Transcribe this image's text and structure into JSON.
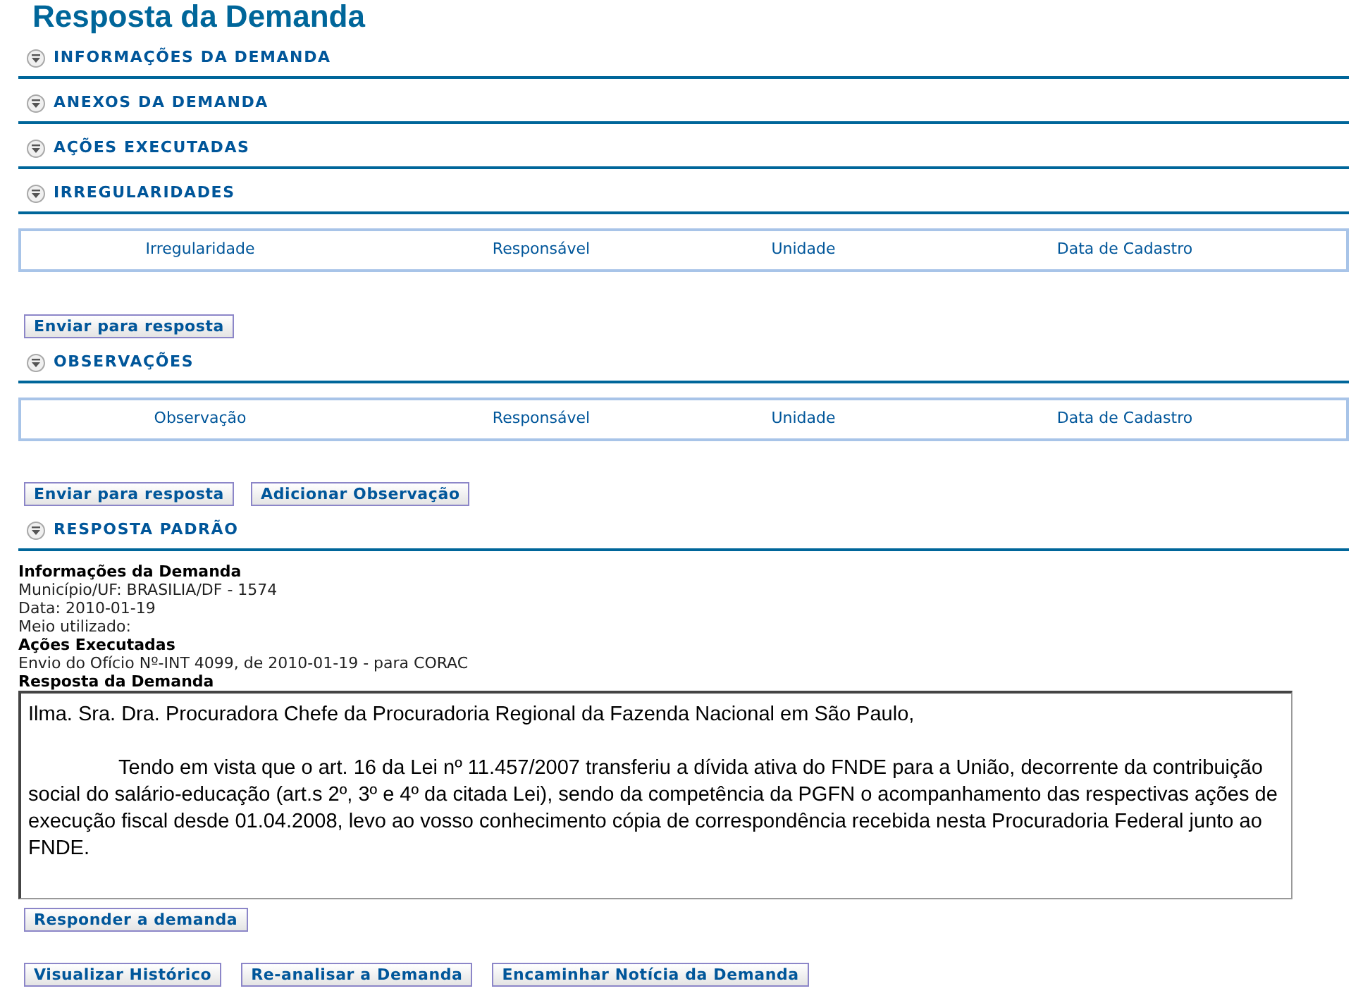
{
  "title": "Resposta da Demanda",
  "sections": [
    {
      "title": "INFORMAÇÕES DA DEMANDA",
      "expanded": true
    },
    {
      "title": "ANEXOS DA DEMANDA",
      "expanded": true
    },
    {
      "title": "AÇÕES EXECUTADAS",
      "expanded": true
    },
    {
      "title": "IRREGULARIDADES",
      "expanded": true,
      "table": {
        "columns": [
          "Irregularidade",
          "Responsável",
          "Unidade",
          "Data de Cadastro"
        ]
      },
      "buttons": [
        "Enviar para resposta"
      ]
    },
    {
      "title": "OBSERVAÇÕES",
      "expanded": true,
      "table": {
        "columns": [
          "Observação",
          "Responsável",
          "Unidade",
          "Data de Cadastro"
        ]
      },
      "buttons": [
        "Enviar para resposta",
        "Adicionar Observação"
      ]
    },
    {
      "title": "RESPOSTA PADRÃO",
      "expanded": true
    }
  ],
  "summary": [
    {
      "kind": "heading",
      "text": "Informações da Demanda"
    },
    {
      "kind": "text",
      "text": "Município/UF: BRASILIA/DF - 1574"
    },
    {
      "kind": "text",
      "text": "Data: 2010-01-19"
    },
    {
      "kind": "text",
      "text": "Meio utilizado:"
    },
    {
      "kind": "heading",
      "text": "Ações Executadas"
    },
    {
      "kind": "text",
      "text": "Envio do Ofício Nº-INT 4099, de 2010-01-19 - para CORAC"
    },
    {
      "kind": "heading",
      "text": "Resposta da Demanda"
    }
  ],
  "response": {
    "paragraphs": [
      {
        "indented": false,
        "text": "Ilma. Sra. Dra. Procuradora Chefe da Procuradoria Regional da Fazenda Nacional em São Paulo,"
      },
      {
        "indented": true,
        "text": "Tendo em vista que o art. 16 da Lei nº 11.457/2007 transferiu a dívida ativa do FNDE para a União, decorrente da contribuição social do salário-educação (art.s 2º, 3º e 4º da citada Lei), sendo da competência da PGFN o acompanhamento das respectivas ações de execução fiscal desde 01.04.2008, levo ao vosso conhecimento cópia de correspondência recebida nesta Procuradoria Federal junto ao FNDE."
      }
    ]
  },
  "button_rows": [
    [
      "Responder a demanda"
    ],
    [
      "Visualizar Histórico",
      "Re-analisar a Demanda",
      "Encaminhar Notícia da Demanda"
    ]
  ]
}
